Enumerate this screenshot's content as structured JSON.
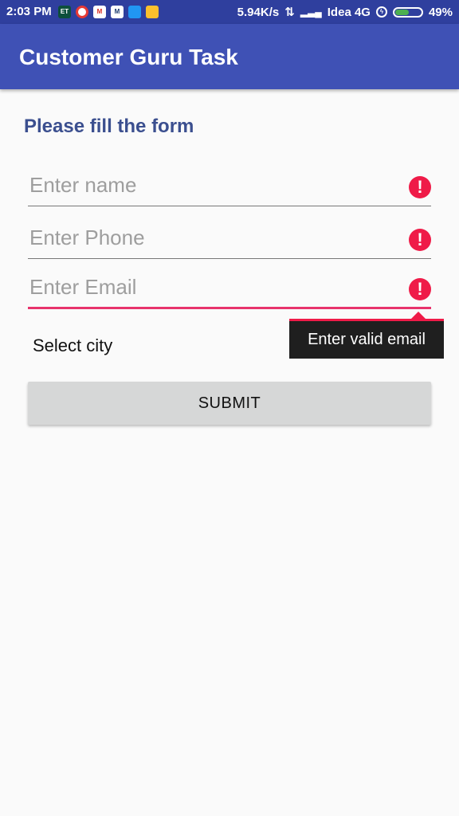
{
  "status_bar": {
    "time": "2:03 PM",
    "app_icons": [
      {
        "name": "et-icon",
        "label": "ET",
        "color": "#0d4f3c"
      },
      {
        "name": "chrome-icon",
        "label": "",
        "color": "#e53935"
      },
      {
        "name": "gmail-icon",
        "label": "M",
        "color": "#ffffff"
      },
      {
        "name": "mint-icon",
        "label": "M",
        "color": "#ffffff"
      },
      {
        "name": "box-app-icon",
        "label": "",
        "color": "#2196f3"
      },
      {
        "name": "keep-icon",
        "label": "",
        "color": "#fbc02d"
      }
    ],
    "network_speed": "5.94K/s",
    "carrier": "Idea 4G",
    "battery_percent": "49%",
    "battery_level": 0.49
  },
  "app_bar": {
    "title": "Customer Guru Task"
  },
  "form": {
    "heading": "Please fill the form",
    "name_field": {
      "placeholder": "Enter name",
      "value": ""
    },
    "phone_field": {
      "placeholder": "Enter Phone",
      "value": ""
    },
    "email_field": {
      "placeholder": "Enter Email",
      "value": ""
    },
    "error_icon_glyph": "!",
    "error_tooltip": "Enter valid email",
    "city_spinner": {
      "label": "Select city"
    },
    "submit_label": "SUBMIT"
  },
  "colors": {
    "primary": "#3f51b5",
    "primary_dark": "#2f3f9e",
    "accent": "#e8336c",
    "error": "#ef1b48"
  }
}
